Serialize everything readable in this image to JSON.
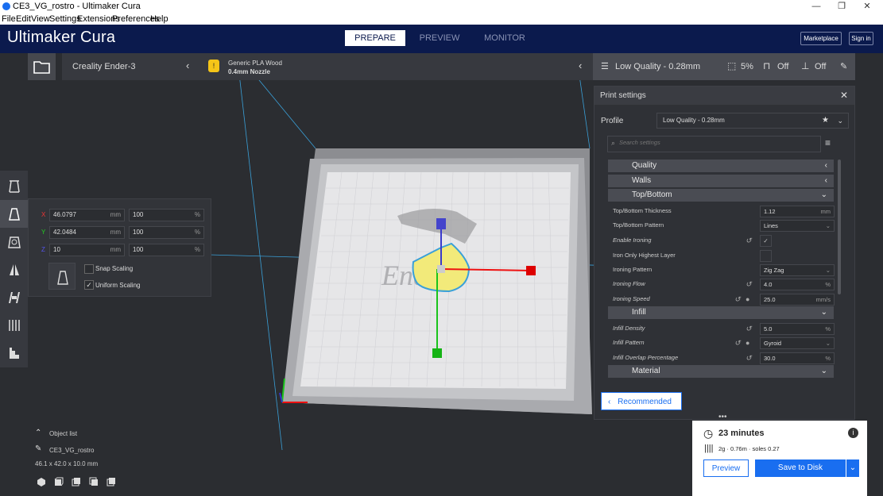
{
  "window": {
    "title": "CE3_VG_rostro - Ultimaker Cura"
  },
  "menu": [
    "File",
    "Edit",
    "View",
    "Settings",
    "Extensions",
    "Preferences",
    "Help"
  ],
  "header": {
    "logo": "Ultimaker Cura",
    "tabs": [
      "PREPARE",
      "PREVIEW",
      "MONITOR"
    ],
    "active_tab": "PREPARE",
    "marketplace": "Marketplace",
    "signin": "Sign in"
  },
  "printer": {
    "name": "Creality Ender-3",
    "material": "Generic PLA Wood",
    "nozzle": "0.4mm Nozzle",
    "material_badge": "!"
  },
  "quick": {
    "profile": "Low Quality - 0.28mm",
    "infill": "5%",
    "support": "Off",
    "adhesion": "Off"
  },
  "scale": {
    "x": {
      "label": "X",
      "mm": "46.0797",
      "pct": "100"
    },
    "y": {
      "label": "Y",
      "mm": "42.0484",
      "pct": "100"
    },
    "z": {
      "label": "Z",
      "mm": "10",
      "pct": "100"
    },
    "unit_mm": "mm",
    "unit_pct": "%",
    "snap": "Snap Scaling",
    "uniform": "Uniform Scaling"
  },
  "print_settings": {
    "title": "Print settings",
    "profile_label": "Profile",
    "profile_value": "Low Quality - 0.28mm",
    "search_placeholder": "Search settings",
    "categories": {
      "quality": "Quality",
      "walls": "Walls",
      "topbottom": "Top/Bottom",
      "infill": "Infill",
      "material": "Material"
    },
    "rows": {
      "tb_thickness": {
        "label": "Top/Bottom Thickness",
        "value": "1.12",
        "unit": "mm"
      },
      "tb_pattern": {
        "label": "Top/Bottom Pattern",
        "value": "Lines"
      },
      "enable_ironing": {
        "label": "Enable Ironing",
        "value": "✓"
      },
      "iron_only": {
        "label": "Iron Only Highest Layer"
      },
      "ironing_pattern": {
        "label": "Ironing Pattern",
        "value": "Zig Zag"
      },
      "ironing_flow": {
        "label": "Ironing Flow",
        "value": "4.0",
        "unit": "%"
      },
      "ironing_speed": {
        "label": "Ironing Speed",
        "value": "25.0",
        "unit": "mm/s"
      },
      "infill_density": {
        "label": "Infill Density",
        "value": "5.0",
        "unit": "%"
      },
      "infill_pattern": {
        "label": "Infill Pattern",
        "value": "Gyroid"
      },
      "infill_overlap": {
        "label": "Infill Overlap Percentage",
        "value": "30.0",
        "unit": "%"
      }
    },
    "recommended": "Recommended"
  },
  "objects": {
    "header": "Object list",
    "name": "CE3_VG_rostro",
    "dims": "46.1 x 42.0 x 10.0 mm"
  },
  "estimate": {
    "time": "23 minutes",
    "material": "2g · 0.76m · soles 0.27",
    "preview": "Preview",
    "save": "Save to Disk"
  },
  "colors": {
    "header": "#0b1a4d",
    "accent": "#196ef0",
    "bed": "#c9c9cc",
    "model": "#f2ea7a"
  }
}
